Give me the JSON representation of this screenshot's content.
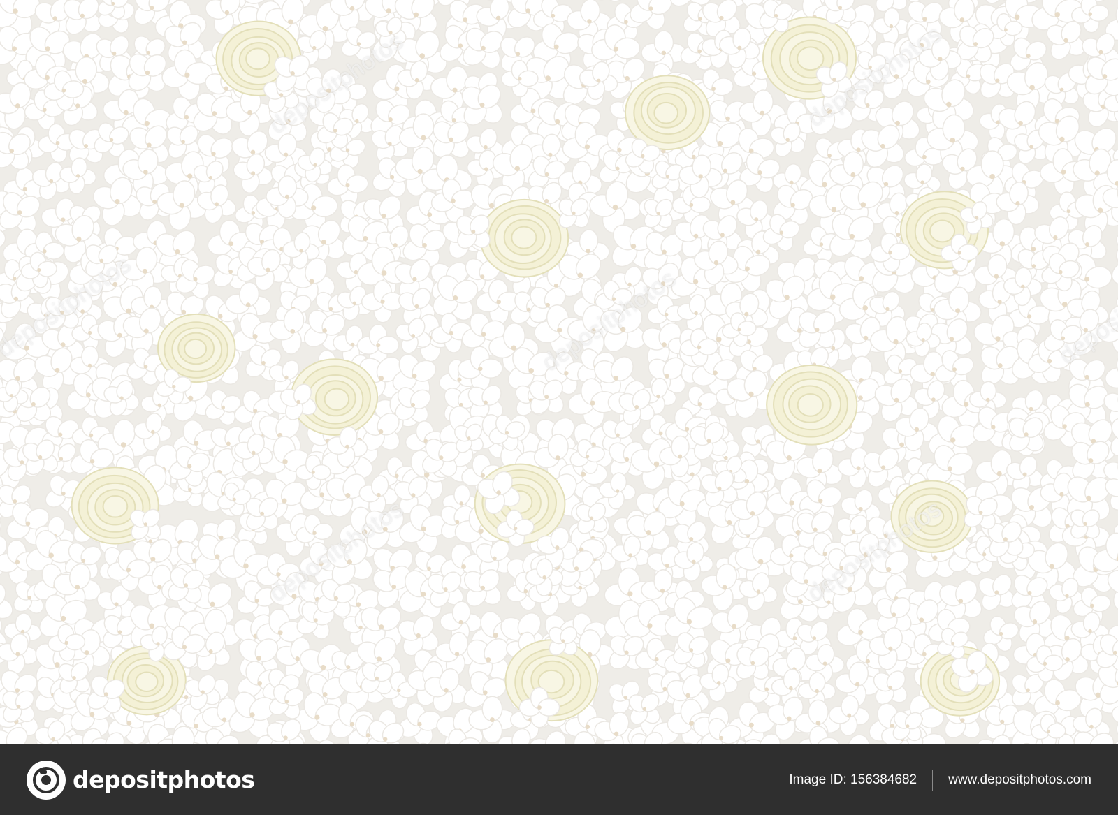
{
  "image": {
    "subject": "flower-wall",
    "colors": {
      "petal": "#ffffff",
      "petal_shade": "#ebe8e3",
      "rose": "#f4f1d6",
      "rose_shade": "#e3dfb9",
      "background": "#efede8"
    }
  },
  "watermark": {
    "text": "depositphotos"
  },
  "footer": {
    "logo_text": "depositphotos",
    "image_id_label": "Image ID: 156384682",
    "website": "www.depositphotos.com",
    "background": "#2f2f2f"
  }
}
